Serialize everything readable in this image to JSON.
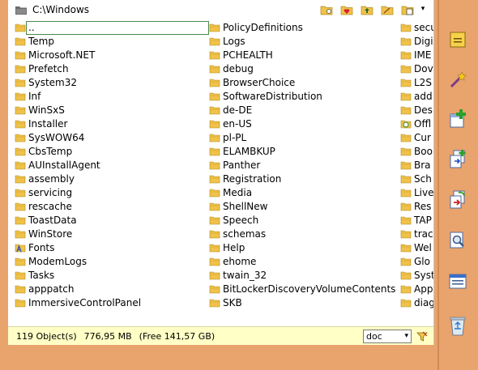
{
  "window": {
    "path": "C:\\Windows"
  },
  "toolbar": {
    "icons": [
      "folder-options-icon",
      "favorites-icon",
      "parent-folder-icon",
      "new-folder-icon",
      "view-mode-icon"
    ],
    "menu_caret": "▾"
  },
  "columns": [
    [
      {
        "name": "..",
        "icon": "folder-up-icon",
        "selected": true
      },
      {
        "name": "Temp",
        "icon": "folder-icon"
      },
      {
        "name": "Microsoft.NET",
        "icon": "folder-icon"
      },
      {
        "name": "Prefetch",
        "icon": "folder-icon"
      },
      {
        "name": "System32",
        "icon": "folder-icon"
      },
      {
        "name": "Inf",
        "icon": "folder-icon"
      },
      {
        "name": "WinSxS",
        "icon": "folder-icon"
      },
      {
        "name": "Installer",
        "icon": "folder-icon"
      },
      {
        "name": "SysWOW64",
        "icon": "folder-icon"
      },
      {
        "name": "CbsTemp",
        "icon": "folder-icon"
      },
      {
        "name": "AUInstallAgent",
        "icon": "folder-icon"
      },
      {
        "name": "assembly",
        "icon": "folder-icon"
      },
      {
        "name": "servicing",
        "icon": "folder-icon"
      },
      {
        "name": "rescache",
        "icon": "folder-icon"
      },
      {
        "name": "ToastData",
        "icon": "folder-icon"
      },
      {
        "name": "WinStore",
        "icon": "folder-icon"
      },
      {
        "name": "Fonts",
        "icon": "fonts-folder-icon"
      },
      {
        "name": "ModemLogs",
        "icon": "folder-icon"
      },
      {
        "name": "Tasks",
        "icon": "folder-icon"
      },
      {
        "name": "apppatch",
        "icon": "folder-icon"
      },
      {
        "name": "ImmersiveControlPanel",
        "icon": "folder-icon"
      }
    ],
    [
      {
        "name": "PolicyDefinitions",
        "icon": "folder-icon"
      },
      {
        "name": "Logs",
        "icon": "folder-icon"
      },
      {
        "name": "PCHEALTH",
        "icon": "folder-icon"
      },
      {
        "name": "debug",
        "icon": "folder-icon"
      },
      {
        "name": "BrowserChoice",
        "icon": "folder-icon"
      },
      {
        "name": "SoftwareDistribution",
        "icon": "folder-icon"
      },
      {
        "name": "de-DE",
        "icon": "folder-icon"
      },
      {
        "name": "en-US",
        "icon": "folder-icon"
      },
      {
        "name": "pl-PL",
        "icon": "folder-icon"
      },
      {
        "name": "ELAMBKUP",
        "icon": "folder-icon"
      },
      {
        "name": "Panther",
        "icon": "folder-icon"
      },
      {
        "name": "Registration",
        "icon": "folder-icon"
      },
      {
        "name": "Media",
        "icon": "folder-icon"
      },
      {
        "name": "ShellNew",
        "icon": "folder-icon"
      },
      {
        "name": "Speech",
        "icon": "folder-icon"
      },
      {
        "name": "schemas",
        "icon": "folder-icon"
      },
      {
        "name": "Help",
        "icon": "folder-icon"
      },
      {
        "name": "ehome",
        "icon": "folder-icon"
      },
      {
        "name": "twain_32",
        "icon": "folder-icon"
      },
      {
        "name": "BitLockerDiscoveryVolumeContents",
        "icon": "folder-icon"
      },
      {
        "name": "SKB",
        "icon": "folder-icon"
      }
    ],
    [
      {
        "name": "secu",
        "icon": "folder-icon"
      },
      {
        "name": "Digi",
        "icon": "folder-icon"
      },
      {
        "name": "IME",
        "icon": "folder-icon"
      },
      {
        "name": "Dov",
        "icon": "folder-icon"
      },
      {
        "name": "L2S",
        "icon": "folder-icon"
      },
      {
        "name": "add",
        "icon": "folder-icon"
      },
      {
        "name": "Des",
        "icon": "folder-icon"
      },
      {
        "name": "Offl",
        "icon": "offline-folder-icon"
      },
      {
        "name": "Cur",
        "icon": "folder-icon"
      },
      {
        "name": "Boo",
        "icon": "folder-icon"
      },
      {
        "name": "Bra",
        "icon": "folder-icon"
      },
      {
        "name": "Sch",
        "icon": "folder-icon"
      },
      {
        "name": "Live",
        "icon": "folder-icon"
      },
      {
        "name": "Res",
        "icon": "folder-icon"
      },
      {
        "name": "TAP",
        "icon": "folder-icon"
      },
      {
        "name": "trac",
        "icon": "folder-icon"
      },
      {
        "name": "Wel",
        "icon": "folder-icon"
      },
      {
        "name": "Glo",
        "icon": "folder-icon"
      },
      {
        "name": "Syst",
        "icon": "folder-icon"
      },
      {
        "name": "App",
        "icon": "folder-icon"
      },
      {
        "name": "diag",
        "icon": "folder-icon"
      }
    ]
  ],
  "status": {
    "objects": "119 Object(s)",
    "size": "776,95 MB",
    "free": "(Free 141,57 GB)"
  },
  "filter": {
    "value": "doc",
    "caret": "▾"
  },
  "sidebar": {
    "icons": [
      "notepad-icon",
      "magic-wand-icon",
      "new-tab-icon",
      "copy-icon",
      "move-icon",
      "find-icon",
      "properties-icon",
      "recycle-bin-icon"
    ]
  },
  "colors": {
    "background": "#e9a36c",
    "status_bar": "#ffffc6",
    "folder": "#f0c24a"
  }
}
